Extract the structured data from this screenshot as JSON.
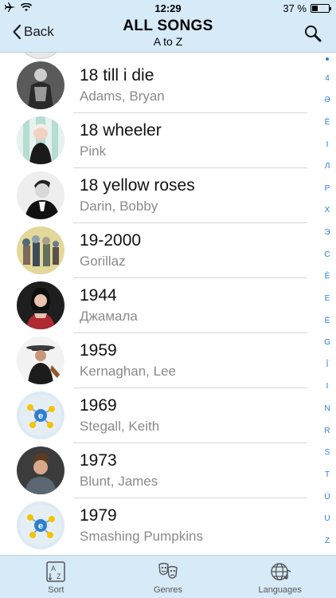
{
  "status": {
    "time": "12:29",
    "battery": "37 %",
    "battery_level": 0.37
  },
  "nav": {
    "back_label": "Back",
    "title": "ALL SONGS",
    "subtitle": "A to Z"
  },
  "songs": [
    {
      "title": "18 till i die",
      "artist": "Adams, Bryan"
    },
    {
      "title": "18 wheeler",
      "artist": "Pink"
    },
    {
      "title": "18 yellow roses",
      "artist": "Darin, Bobby"
    },
    {
      "title": "19-2000",
      "artist": "Gorillaz"
    },
    {
      "title": "1944",
      "artist": "Джамала"
    },
    {
      "title": "1959",
      "artist": "Kernaghan, Lee"
    },
    {
      "title": "1969",
      "artist": "Stegall, Keith"
    },
    {
      "title": "1973",
      "artist": "Blunt, James"
    },
    {
      "title": "1979",
      "artist": "Smashing Pumpkins"
    }
  ],
  "index": [
    "4",
    "Ə",
    "Ë",
    "I",
    "Л",
    "Р",
    "Х",
    "Э",
    "С",
    "È",
    "Е",
    "È",
    "G",
    "Î",
    "I",
    "N",
    "R",
    "S",
    "T",
    "Ü",
    "U",
    "Z"
  ],
  "tabs": [
    {
      "label": "Sort",
      "icon": "sort-az-icon"
    },
    {
      "label": "Genres",
      "icon": "masks-icon"
    },
    {
      "label": "Languages",
      "icon": "globe-note-icon"
    }
  ],
  "colors": {
    "bar_background": "#d6eaf8",
    "index_accent": "#2a7fd6"
  }
}
